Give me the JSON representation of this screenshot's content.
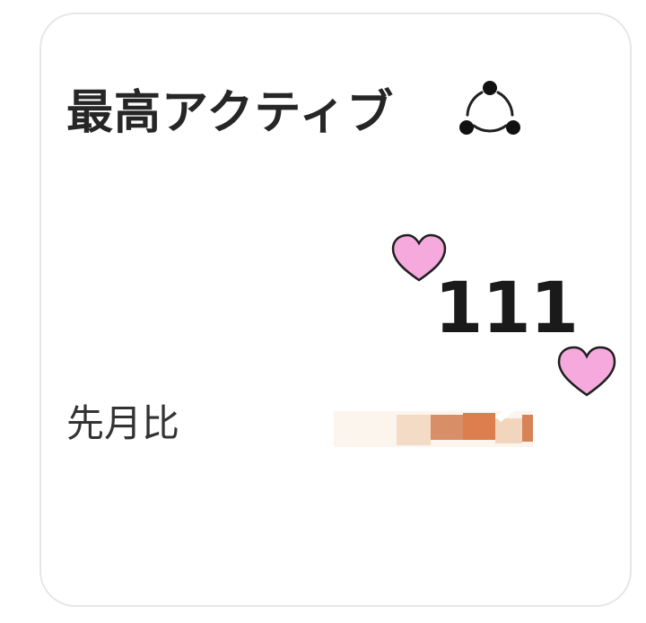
{
  "card": {
    "title": "最高アクティブ",
    "share_icon": "share-icon",
    "value": "111",
    "compare_label": "先月比"
  },
  "decorations": {
    "heart_icon": "heart-icon",
    "heart_color": "#f6a9dc",
    "heart_stroke": "#1f1f1f"
  }
}
